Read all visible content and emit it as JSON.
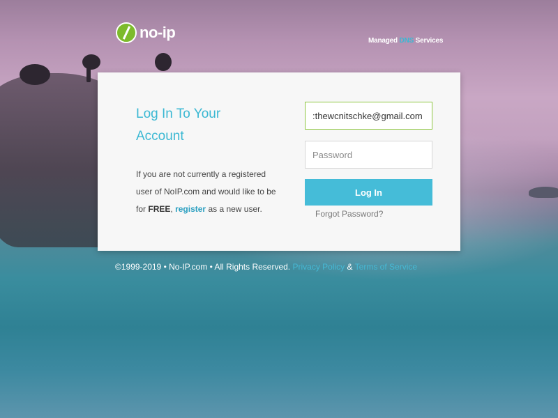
{
  "header": {
    "logo_text": "no-ip",
    "tagline_prefix": "Managed",
    "tagline_highlight": "DNS",
    "tagline_suffix": "Services"
  },
  "login_card": {
    "title": "Log In To Your Account",
    "description_part1": "If you are not currently a registered user of NoIP.com and would like to be for",
    "description_bold": "FREE",
    "description_comma": ",",
    "register_link": "register",
    "description_part2": "as a new user.",
    "email_value": ":thewcnitschke@gmail.com",
    "password_placeholder": "Password",
    "login_button": "Log In",
    "forgot_password": "Forgot Password?"
  },
  "footer": {
    "copyright": "©1999-2019 • No-IP.com • All Rights Reserved.",
    "privacy_link": "Privacy Policy",
    "ampersand": "&",
    "terms_link": "Terms of Service"
  },
  "colors": {
    "accent": "#3bb8d3",
    "button": "#45bcd8",
    "logo_green": "#7dbb2c",
    "focus_border": "#8dc63f"
  },
  "icons": {
    "logo": "noip-logo-icon"
  }
}
